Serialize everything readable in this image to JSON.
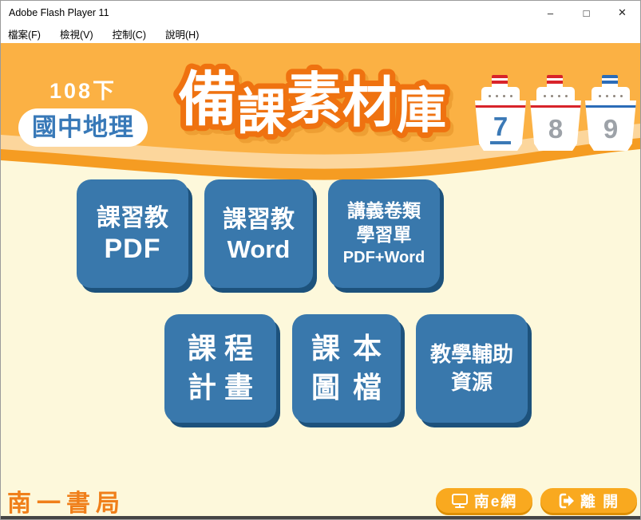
{
  "window": {
    "title": "Adobe Flash Player 11",
    "controls": {
      "minimize": "–",
      "maximize": "□",
      "close": "✕"
    }
  },
  "menu": {
    "items": [
      {
        "label": "檔案(F)"
      },
      {
        "label": "檢視(V)"
      },
      {
        "label": "控制(C)"
      },
      {
        "label": "說明(H)"
      }
    ]
  },
  "header": {
    "edition": "108下",
    "subject": "國中地理",
    "title": "備課素材庫",
    "title_chars": [
      "備",
      "課",
      "素",
      "材",
      "庫"
    ],
    "volumes": [
      {
        "number": "7",
        "active": true
      },
      {
        "number": "8",
        "active": false
      },
      {
        "number": "9",
        "active": false
      }
    ]
  },
  "buttons": [
    {
      "id": "kexijiao-pdf",
      "lines": [
        "課習教",
        "PDF"
      ]
    },
    {
      "id": "kexijiao-word",
      "lines": [
        "課習教",
        "Word"
      ]
    },
    {
      "id": "handout-sheets",
      "lines": [
        "講義卷類",
        "學習單",
        "PDF+Word"
      ]
    },
    {
      "id": "course-plan",
      "lines": [
        "課程",
        "計畫"
      ]
    },
    {
      "id": "textbook-images",
      "lines": [
        "課本",
        "圖檔"
      ]
    },
    {
      "id": "teaching-aids",
      "lines": [
        "教學輔助",
        "資源"
      ]
    }
  ],
  "footer": {
    "publisher": "南一書局",
    "nan_e_net_label": "南e網",
    "exit_label": "離 開"
  },
  "colors": {
    "header_orange": "#FBB144",
    "wave_peach": "#FCD69C",
    "wave_stripe": "#F59C22",
    "body_cream": "#FDF8DB",
    "button_blue": "#3978AC",
    "button_blue_shadow": "#1D527C",
    "title_outline": "#EF7210",
    "subject_blue": "#3879B8",
    "pill_orange": "#F9A91F",
    "publisher_orange": "#F07F1A",
    "active_volume_blue": "#3B79B6"
  }
}
